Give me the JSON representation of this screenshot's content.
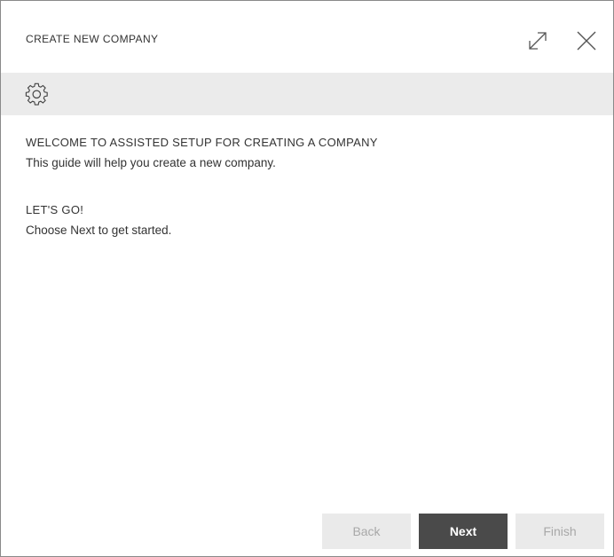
{
  "dialog": {
    "title": "CREATE NEW COMPANY",
    "expand_icon": "expand-arrows-icon",
    "close_icon": "close-icon"
  },
  "toolbar": {
    "settings_icon": "gear-icon"
  },
  "content": {
    "welcome_heading": "WELCOME TO ASSISTED SETUP FOR CREATING A COMPANY",
    "welcome_text": "This guide will help you create a new company.",
    "letsgo_heading": "LET'S GO!",
    "letsgo_text": "Choose Next to get started."
  },
  "footer": {
    "back_label": "Back",
    "next_label": "Next",
    "finish_label": "Finish"
  },
  "colors": {
    "toolbar_bg": "#ebebeb",
    "primary_button": "#4a4a4a",
    "disabled_button": "#eaeaea",
    "disabled_text": "#a8a8a8"
  }
}
